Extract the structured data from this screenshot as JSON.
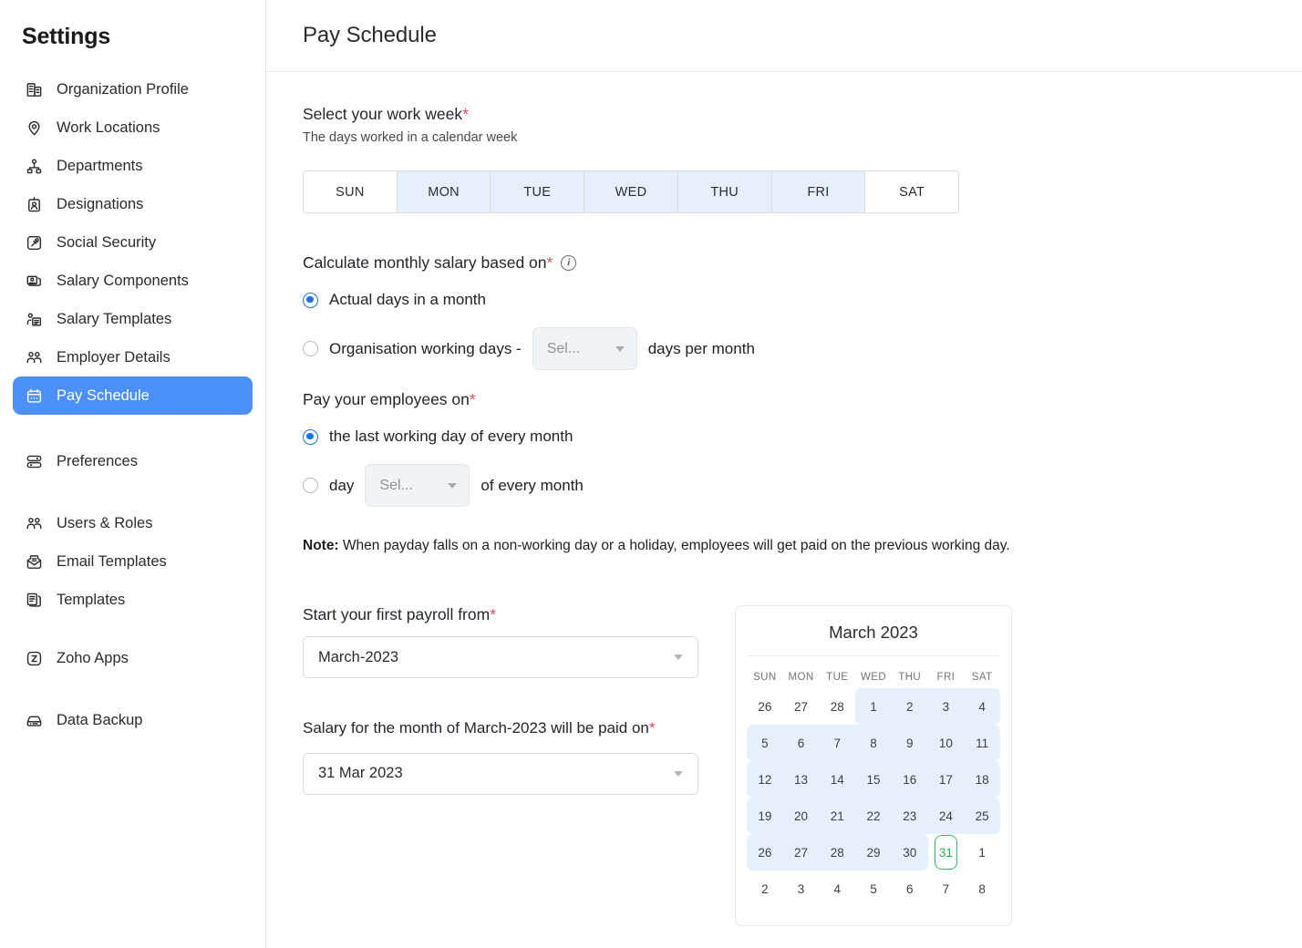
{
  "sidebar": {
    "title": "Settings",
    "groups": [
      {
        "items": [
          {
            "label": "Organization Profile",
            "icon": "building-icon",
            "name": "sidebar-item-organization-profile",
            "active": false
          },
          {
            "label": "Work Locations",
            "icon": "map-pin-icon",
            "name": "sidebar-item-work-locations",
            "active": false
          },
          {
            "label": "Departments",
            "icon": "org-chart-icon",
            "name": "sidebar-item-departments",
            "active": false
          },
          {
            "label": "Designations",
            "icon": "id-badge-icon",
            "name": "sidebar-item-designations",
            "active": false
          },
          {
            "label": "Social Security",
            "icon": "gavel-icon",
            "name": "sidebar-item-social-security",
            "active": false
          },
          {
            "label": "Salary Components",
            "icon": "cards-icon",
            "name": "sidebar-item-salary-components",
            "active": false
          },
          {
            "label": "Salary Templates",
            "icon": "person-document-icon",
            "name": "sidebar-item-salary-templates",
            "active": false
          },
          {
            "label": "Employer Details",
            "icon": "people-icon",
            "name": "sidebar-item-employer-details",
            "active": false
          },
          {
            "label": "Pay Schedule",
            "icon": "calendar-icon",
            "name": "sidebar-item-pay-schedule",
            "active": true
          }
        ]
      },
      {
        "items": [
          {
            "label": "Preferences",
            "icon": "sliders-icon",
            "name": "sidebar-item-preferences",
            "active": false
          }
        ]
      },
      {
        "items": [
          {
            "label": "Users & Roles",
            "icon": "people-icon",
            "name": "sidebar-item-users-roles",
            "active": false
          },
          {
            "label": "Email Templates",
            "icon": "envelope-icon",
            "name": "sidebar-item-email-templates",
            "active": false
          },
          {
            "label": "Templates",
            "icon": "documents-icon",
            "name": "sidebar-item-templates",
            "active": false
          }
        ]
      },
      {
        "items": [
          {
            "label": "Zoho Apps",
            "icon": "zoho-icon",
            "name": "sidebar-item-zoho-apps",
            "active": false
          }
        ]
      },
      {
        "items": [
          {
            "label": "Data Backup",
            "icon": "drive-icon",
            "name": "sidebar-item-data-backup",
            "active": false
          }
        ]
      }
    ]
  },
  "header": {
    "title": "Pay Schedule"
  },
  "work_week": {
    "label": "Select your work week",
    "required_mark": "*",
    "sublabel": "The days worked in a calendar week",
    "days": [
      {
        "label": "SUN",
        "selected": false
      },
      {
        "label": "MON",
        "selected": true
      },
      {
        "label": "TUE",
        "selected": true
      },
      {
        "label": "WED",
        "selected": true
      },
      {
        "label": "THU",
        "selected": true
      },
      {
        "label": "FRI",
        "selected": true
      },
      {
        "label": "SAT",
        "selected": false
      }
    ]
  },
  "salary_basis": {
    "label": "Calculate monthly salary based on",
    "required_mark": "*",
    "info_glyph": "i",
    "option_actual": "Actual days in a month",
    "option_org_prefix": "Organisation working days -",
    "option_org_suffix": "days per month",
    "org_days_select": "Sel...",
    "selected": "actual"
  },
  "pay_on": {
    "label": "Pay your employees on",
    "required_mark": "*",
    "option_last_working_day": "the last working day of every month",
    "option_day_prefix": "day",
    "option_day_suffix": "of every month",
    "day_select": "Sel...",
    "selected": "last_working_day"
  },
  "note": {
    "prefix": "Note:",
    "text": " When payday falls on a non-working day or a holiday, employees will get paid on the previous working day."
  },
  "first_payroll": {
    "label": "Start your first payroll from",
    "required_mark": "*",
    "value": "March-2023"
  },
  "salary_paid_on": {
    "label": "Salary for the month of March-2023 will be paid on",
    "required_mark": "*",
    "value": "31 Mar 2023"
  },
  "calendar": {
    "title": "March 2023",
    "dow": [
      "SUN",
      "MON",
      "TUE",
      "WED",
      "THU",
      "FRI",
      "SAT"
    ],
    "weeks": [
      [
        {
          "d": "26",
          "hl": false,
          "today": false
        },
        {
          "d": "27",
          "hl": false,
          "today": false
        },
        {
          "d": "28",
          "hl": false,
          "today": false
        },
        {
          "d": "1",
          "hl": true,
          "today": false,
          "start": true
        },
        {
          "d": "2",
          "hl": true,
          "today": false
        },
        {
          "d": "3",
          "hl": true,
          "today": false
        },
        {
          "d": "4",
          "hl": true,
          "today": false,
          "end": true
        }
      ],
      [
        {
          "d": "5",
          "hl": true,
          "today": false,
          "start": true
        },
        {
          "d": "6",
          "hl": true,
          "today": false
        },
        {
          "d": "7",
          "hl": true,
          "today": false
        },
        {
          "d": "8",
          "hl": true,
          "today": false
        },
        {
          "d": "9",
          "hl": true,
          "today": false
        },
        {
          "d": "10",
          "hl": true,
          "today": false
        },
        {
          "d": "11",
          "hl": true,
          "today": false,
          "end": true
        }
      ],
      [
        {
          "d": "12",
          "hl": true,
          "today": false,
          "start": true
        },
        {
          "d": "13",
          "hl": true,
          "today": false
        },
        {
          "d": "14",
          "hl": true,
          "today": false
        },
        {
          "d": "15",
          "hl": true,
          "today": false
        },
        {
          "d": "16",
          "hl": true,
          "today": false
        },
        {
          "d": "17",
          "hl": true,
          "today": false
        },
        {
          "d": "18",
          "hl": true,
          "today": false,
          "end": true
        }
      ],
      [
        {
          "d": "19",
          "hl": true,
          "today": false,
          "start": true
        },
        {
          "d": "20",
          "hl": true,
          "today": false
        },
        {
          "d": "21",
          "hl": true,
          "today": false
        },
        {
          "d": "22",
          "hl": true,
          "today": false
        },
        {
          "d": "23",
          "hl": true,
          "today": false
        },
        {
          "d": "24",
          "hl": true,
          "today": false
        },
        {
          "d": "25",
          "hl": true,
          "today": false,
          "end": true
        }
      ],
      [
        {
          "d": "26",
          "hl": true,
          "today": false,
          "start": true
        },
        {
          "d": "27",
          "hl": true,
          "today": false
        },
        {
          "d": "28",
          "hl": true,
          "today": false
        },
        {
          "d": "29",
          "hl": true,
          "today": false
        },
        {
          "d": "30",
          "hl": true,
          "today": false,
          "end": true
        },
        {
          "d": "31",
          "hl": false,
          "today": true
        },
        {
          "d": "1",
          "hl": false,
          "today": false
        }
      ],
      [
        {
          "d": "2",
          "hl": false,
          "today": false
        },
        {
          "d": "3",
          "hl": false,
          "today": false
        },
        {
          "d": "4",
          "hl": false,
          "today": false
        },
        {
          "d": "5",
          "hl": false,
          "today": false
        },
        {
          "d": "6",
          "hl": false,
          "today": false
        },
        {
          "d": "7",
          "hl": false,
          "today": false
        },
        {
          "d": "8",
          "hl": false,
          "today": false
        }
      ]
    ]
  },
  "colors": {
    "accent_blue": "#4a90f7",
    "radio_blue": "#1a73e8",
    "highlight_blue": "#e6f0fd",
    "today_green": "#25c25f",
    "required_red": "#f0465a"
  }
}
